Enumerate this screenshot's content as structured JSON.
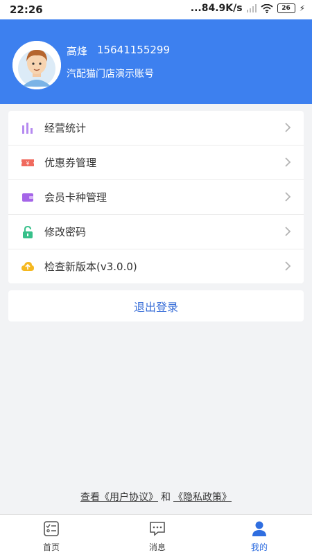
{
  "status_bar": {
    "time": "22:26",
    "network_speed": "...84.9K/s",
    "battery": "26"
  },
  "profile": {
    "name": "高烽",
    "phone": "15641155299",
    "store": "汽配猫门店演示账号"
  },
  "menu": [
    {
      "label": "经营统计",
      "icon": "bar-chart-icon",
      "color": "#b58af0"
    },
    {
      "label": "优惠券管理",
      "icon": "coupon-icon",
      "color": "#f06a5e"
    },
    {
      "label": "会员卡种管理",
      "icon": "wallet-icon",
      "color": "#a565e8"
    },
    {
      "label": "修改密码",
      "icon": "lock-icon",
      "color": "#37c08a"
    },
    {
      "label": "检查新版本(v3.0.0)",
      "icon": "cloud-upload-icon",
      "color": "#f5b820"
    }
  ],
  "logout_label": "退出登录",
  "agreement": {
    "prefix": "查看",
    "user_agreement": "《用户协议》",
    "and": "和",
    "privacy_policy": "《隐私政策》"
  },
  "tabs": [
    {
      "label": "首页",
      "icon": "home-checklist-icon"
    },
    {
      "label": "消息",
      "icon": "message-icon"
    },
    {
      "label": "我的",
      "icon": "user-icon",
      "active": true
    }
  ],
  "colors": {
    "header_bg": "#3d80ef",
    "accent": "#2f6ee0",
    "page_bg": "#f2f3f5"
  }
}
